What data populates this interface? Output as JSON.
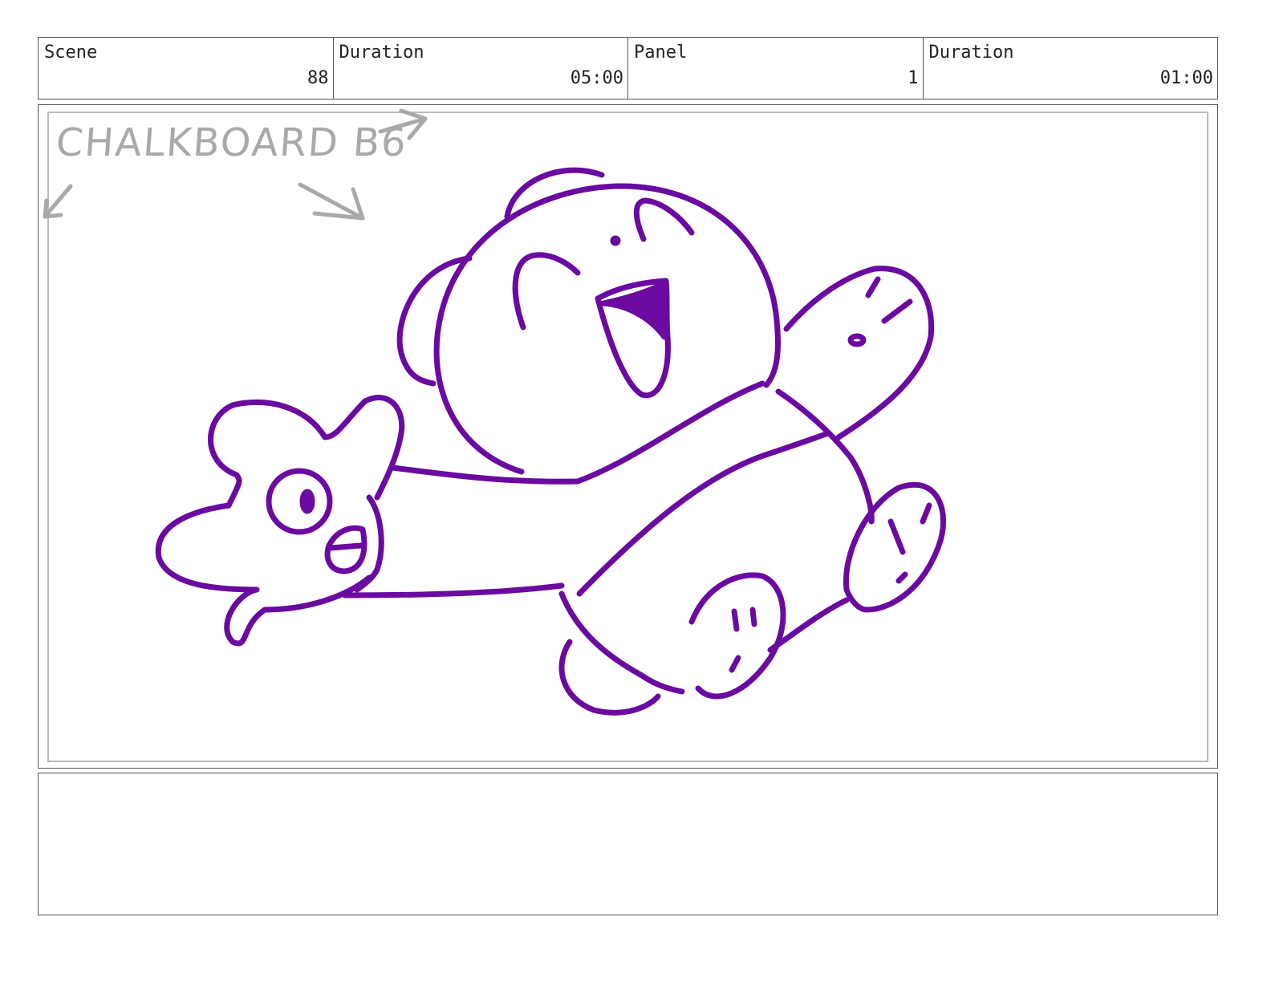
{
  "header": {
    "scene_label": "Scene",
    "scene_value": "88",
    "scene_duration_label": "Duration",
    "scene_duration_value": "05:00",
    "panel_label": "Panel",
    "panel_value": "1",
    "panel_duration_label": "Duration",
    "panel_duration_value": "01:00"
  },
  "panel": {
    "annotation_text": "CHALKBOARD B6",
    "line_color": "#6a0aa0",
    "annotation_color": "#a9a9a9"
  },
  "notes": {
    "text": ""
  }
}
